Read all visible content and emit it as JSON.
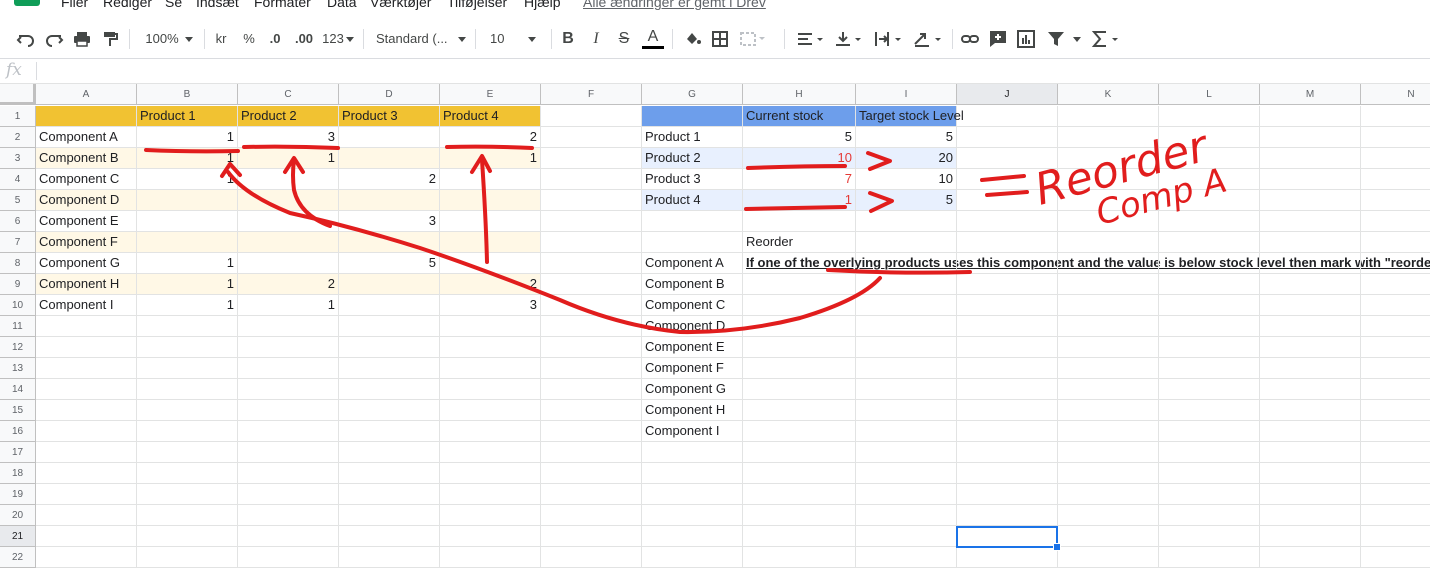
{
  "menu": {
    "items": [
      "Filer",
      "Rediger",
      "Se",
      "Indsæt",
      "Formater",
      "Data",
      "Værktøjer",
      "Tilføjelser",
      "Hjælp"
    ],
    "saved_status": "Alle ændringer er gemt i Drev"
  },
  "toolbar": {
    "zoom": "100%",
    "currency": "kr",
    "percent": "%",
    "decrease_decimals": ".0",
    "increase_decimals": ".00",
    "more_formats": "123",
    "font": "Standard (...",
    "font_size": "10",
    "bold": "B",
    "italic": "I",
    "strikethrough": "S",
    "text_color": "A"
  },
  "formula_bar": {
    "fx": "fx",
    "value": ""
  },
  "columns": [
    "A",
    "B",
    "C",
    "D",
    "E",
    "F",
    "G",
    "H",
    "I",
    "J",
    "K",
    "L",
    "M",
    "N"
  ],
  "rows": [
    "1",
    "2",
    "3",
    "4",
    "5",
    "6",
    "7",
    "8",
    "9",
    "10",
    "11",
    "12",
    "13",
    "14",
    "15",
    "16",
    "17",
    "18",
    "19",
    "20",
    "21",
    "22"
  ],
  "left_table": {
    "headers": [
      "Product 1",
      "Product 2",
      "Product 3",
      "Product 4"
    ],
    "components": [
      "Component A",
      "Component B",
      "Component C",
      "Component D",
      "Component E",
      "Component F",
      "Component G",
      "Component H",
      "Component I"
    ],
    "values": [
      [
        "1",
        "3",
        "",
        "2"
      ],
      [
        "1",
        "1",
        "",
        "1"
      ],
      [
        "1",
        "",
        "2",
        ""
      ],
      [
        "",
        "",
        "",
        ""
      ],
      [
        "",
        "",
        "3",
        ""
      ],
      [
        "",
        "",
        "",
        ""
      ],
      [
        "1",
        "",
        "5",
        ""
      ],
      [
        "1",
        "2",
        "",
        "2"
      ],
      [
        "1",
        "1",
        "",
        "3"
      ]
    ]
  },
  "stock_table": {
    "headers": [
      "Current stock",
      "Target stock Level"
    ],
    "rows": [
      {
        "product": "Product 1",
        "current": "5",
        "target": "5"
      },
      {
        "product": "Product 2",
        "current": "10",
        "target": "20"
      },
      {
        "product": "Product 3",
        "current": "7",
        "target": "10"
      },
      {
        "product": "Product 4",
        "current": "1",
        "target": "5"
      }
    ]
  },
  "reorder": {
    "header": "Reorder",
    "components": [
      "Component A",
      "Component B",
      "Component C",
      "Component D",
      "Component E",
      "Component F",
      "Component G",
      "Component H",
      "Component I"
    ],
    "note": "If one of the overlying products uses this component and the value is below stock level then mark with \"reorde"
  },
  "annotation": {
    "equals": "=",
    "reorder_word": "Reorder",
    "comp_word": "Comp A",
    "ink_color": "#e11d1d"
  },
  "colors": {
    "header_yellow": "#f1c232",
    "row_yellow": "#fff8e6",
    "header_blue": "#6d9eeb",
    "row_blue": "#e8f0fe",
    "selection": "#1a73e8"
  }
}
